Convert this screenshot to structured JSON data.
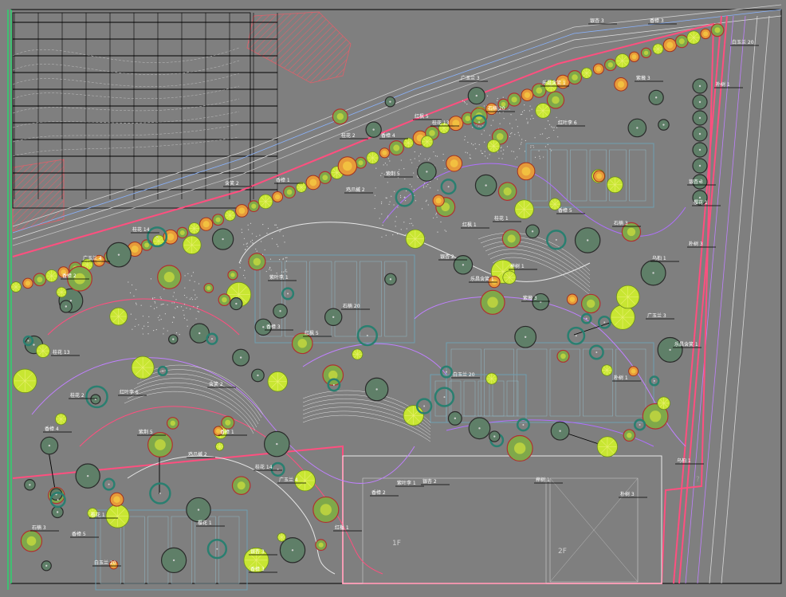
{
  "drawing": {
    "background_color": "#7f7f7f",
    "frame_color": "#000000",
    "accent_green": "#00ff66",
    "building_labels": [
      "1F",
      "2F"
    ],
    "mark_label": "?",
    "plant_labels": [
      "银杏 3",
      "香樟 3",
      "白玉兰 20",
      "乐昌含笑 1",
      "朴树 1",
      "广玉兰 3",
      "紫薇 3",
      "石楠 20",
      "红枫 5",
      "桂花 13",
      "桂花 2",
      "香樟 4",
      "红叶李 6",
      "紫荆 5",
      "鸡爪槭 2",
      "香樟 1",
      "含笑 2",
      "桂花 14",
      "广玉兰 4",
      "香樟 2",
      "紫叶李 1",
      "银杏 2",
      "榉树 1",
      "朴树 3",
      "乌桕 1",
      "红枫 1",
      "桂花 1",
      "香樟 5",
      "石楠 3",
      "樱花 1"
    ],
    "label_color": "#ffffff",
    "tree_fill_colors": [
      "#c8e632",
      "#e6b432",
      "#7fa84a",
      "#5f7f68",
      "#2f8f7f"
    ],
    "line_colors": {
      "road": "#ff4f7f",
      "path": "#c080ff",
      "contour": "#e0e0e0",
      "hatch": "#e0606a",
      "grid": "#000000",
      "water": "#8ab4ff"
    }
  }
}
